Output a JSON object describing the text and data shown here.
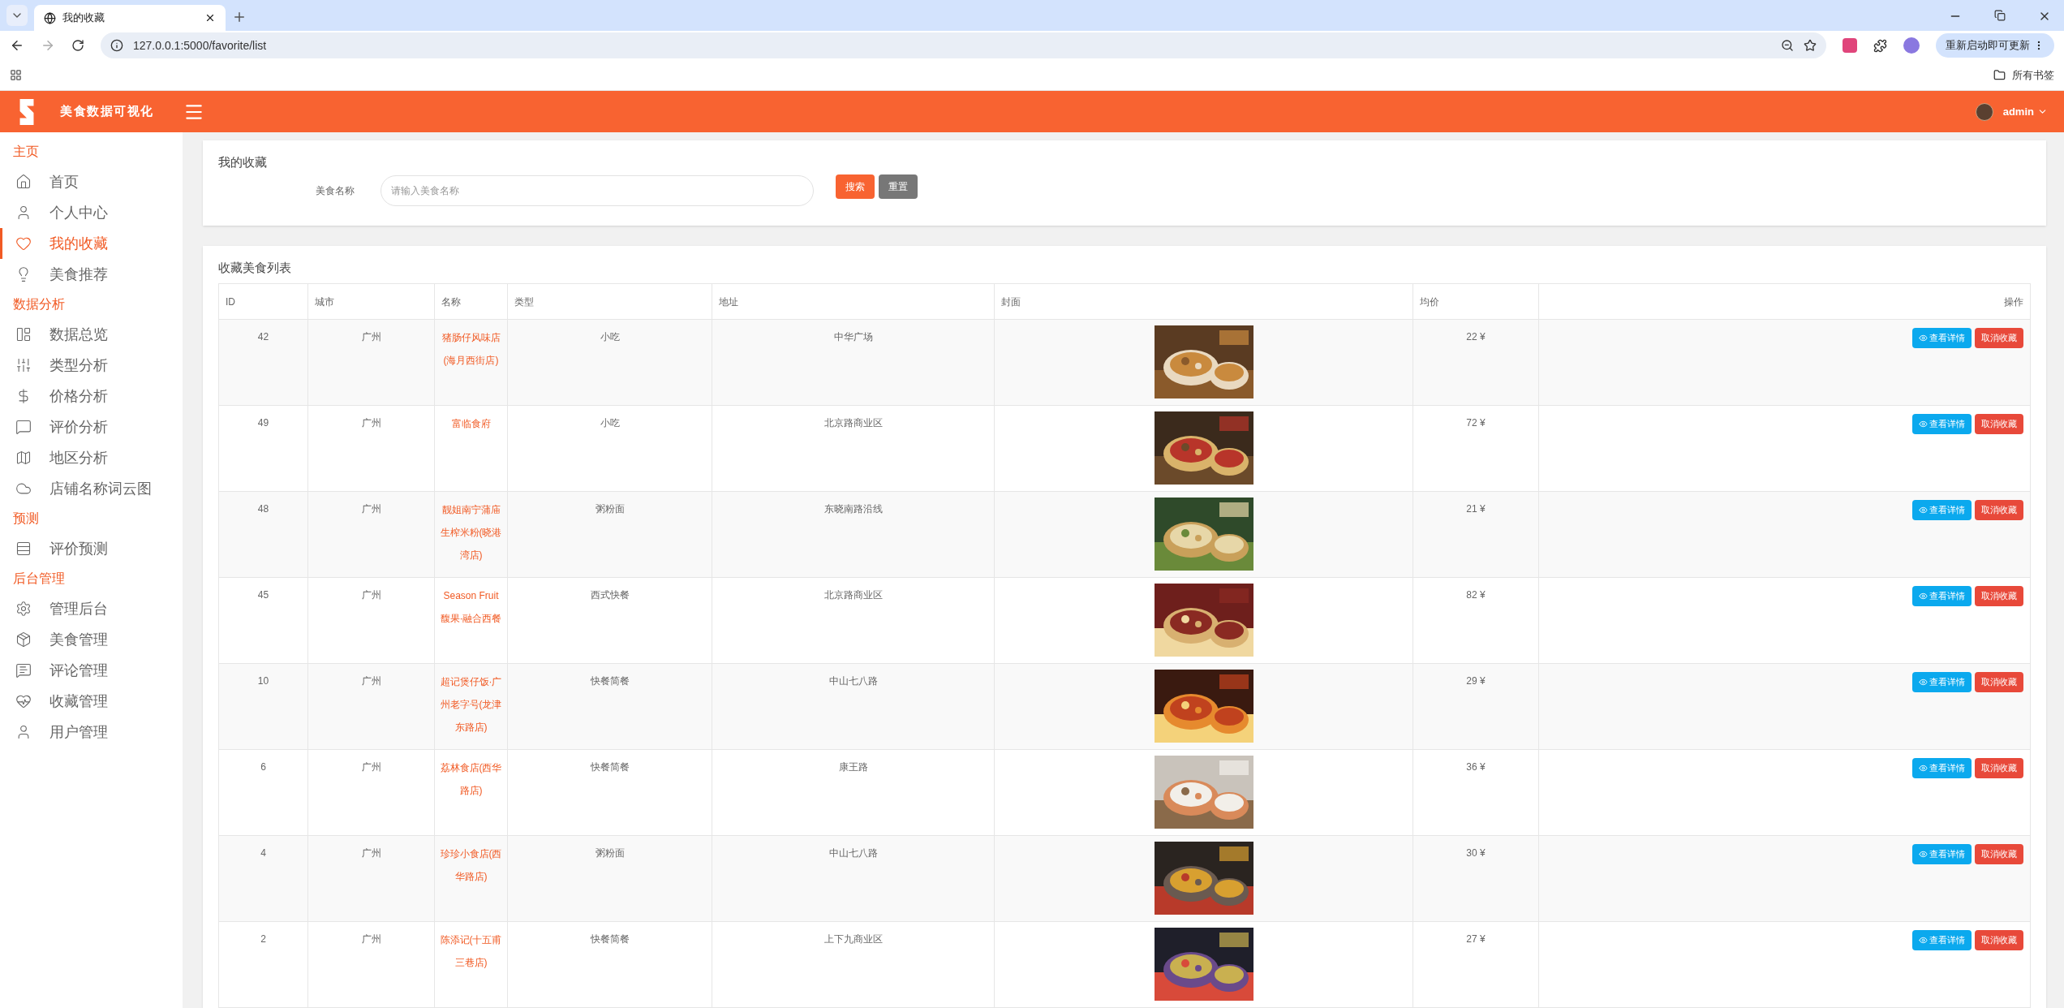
{
  "browser": {
    "tab_title": "我的收藏",
    "url": "127.0.0.1:5000/favorite/list",
    "update_button": "重新启动即可更新",
    "bookmarks_folder": "所有书签"
  },
  "header": {
    "app_title": "美食数据可视化",
    "username": "admin"
  },
  "sidebar": {
    "sections": [
      {
        "title": "主页",
        "items": [
          {
            "label": "首页",
            "selected": false
          },
          {
            "label": "个人中心",
            "selected": false
          },
          {
            "label": "我的收藏",
            "selected": true
          },
          {
            "label": "美食推荐",
            "selected": false
          }
        ]
      },
      {
        "title": "数据分析",
        "items": [
          {
            "label": "数据总览",
            "selected": false
          },
          {
            "label": "类型分析",
            "selected": false
          },
          {
            "label": "价格分析",
            "selected": false
          },
          {
            "label": "评价分析",
            "selected": false
          },
          {
            "label": "地区分析",
            "selected": false
          },
          {
            "label": "店铺名称词云图",
            "selected": false
          }
        ]
      },
      {
        "title": "预测",
        "items": [
          {
            "label": "评价预测",
            "selected": false
          }
        ]
      },
      {
        "title": "后台管理",
        "items": [
          {
            "label": "管理后台",
            "selected": false
          },
          {
            "label": "美食管理",
            "selected": false
          },
          {
            "label": "评论管理",
            "selected": false
          },
          {
            "label": "收藏管理",
            "selected": false
          },
          {
            "label": "用户管理",
            "selected": false
          }
        ]
      }
    ]
  },
  "search_panel": {
    "title": "我的收藏",
    "field_label": "美食名称",
    "placeholder": "请输入美食名称",
    "search_button": "搜索",
    "reset_button": "重置"
  },
  "list_panel": {
    "title": "收藏美食列表",
    "columns": [
      "ID",
      "城市",
      "名称",
      "类型",
      "地址",
      "封面",
      "均价",
      "操作"
    ],
    "rows": [
      {
        "id": "42",
        "city": "广州",
        "name": "猪肠仔风味店(海月西街店)",
        "type": "小吃",
        "address": "中华广场",
        "price": "22 ¥",
        "actions": [
          "查看详情",
          "取消收藏"
        ]
      },
      {
        "id": "49",
        "city": "广州",
        "name": "富临食府",
        "type": "小吃",
        "address": "北京路商业区",
        "price": "72 ¥",
        "actions": [
          "查看详情",
          "取消收藏"
        ]
      },
      {
        "id": "48",
        "city": "广州",
        "name": "靓姐南宁蒲庙生榨米粉(晓港湾店)",
        "type": "粥粉面",
        "address": "东晓南路沿线",
        "price": "21 ¥",
        "actions": [
          "查看详情",
          "取消收藏"
        ]
      },
      {
        "id": "45",
        "city": "广州",
        "name": "Season Fruit 馥果·融合西餐",
        "type": "西式快餐",
        "address": "北京路商业区",
        "price": "82 ¥",
        "actions": [
          "查看详情",
          "取消收藏"
        ]
      },
      {
        "id": "10",
        "city": "广州",
        "name": "超记煲仔饭·广州老字号(龙津东路店)",
        "type": "快餐简餐",
        "address": "中山七八路",
        "price": "29 ¥",
        "actions": [
          "查看详情",
          "取消收藏"
        ]
      },
      {
        "id": "6",
        "city": "广州",
        "name": "荔林食店(西华路店)",
        "type": "快餐简餐",
        "address": "康王路",
        "price": "36 ¥",
        "actions": [
          "查看详情",
          "取消收藏"
        ]
      },
      {
        "id": "4",
        "city": "广州",
        "name": "珍珍小食店(西华路店)",
        "type": "粥粉面",
        "address": "中山七八路",
        "price": "30 ¥",
        "actions": [
          "查看详情",
          "取消收藏"
        ]
      },
      {
        "id": "2",
        "city": "广州",
        "name": "陈添记(十五甫三巷店)",
        "type": "快餐简餐",
        "address": "上下九商业区",
        "price": "27 ¥",
        "actions": [
          "查看详情",
          "取消收藏"
        ]
      }
    ]
  }
}
